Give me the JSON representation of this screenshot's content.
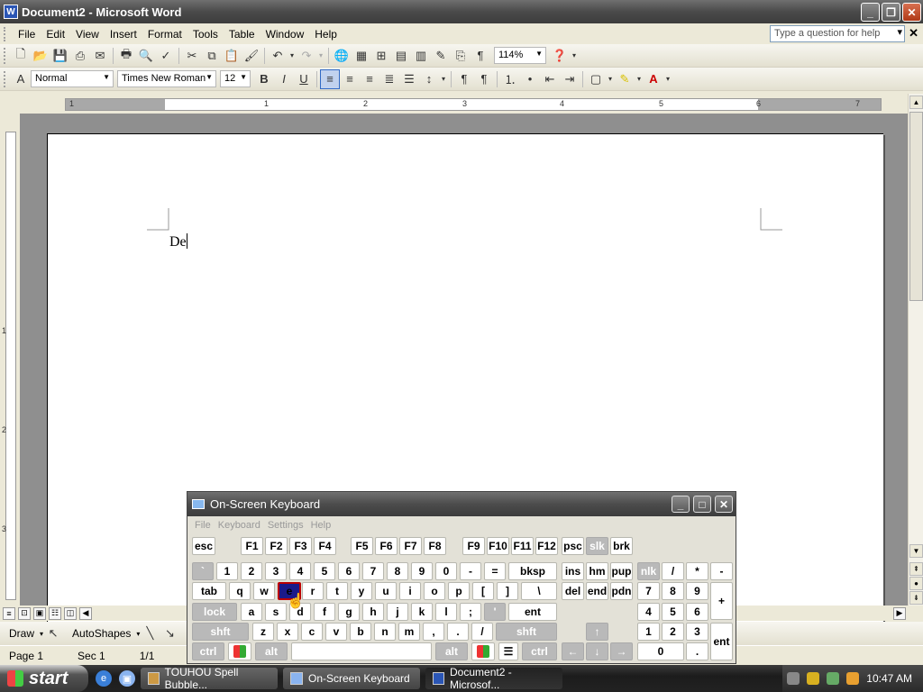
{
  "window": {
    "title": "Document2 - Microsoft Word",
    "icon_letter": "W"
  },
  "menu": {
    "items": [
      "File",
      "Edit",
      "View",
      "Insert",
      "Format",
      "Tools",
      "Table",
      "Window",
      "Help"
    ],
    "help_placeholder": "Type a question for help"
  },
  "formatting": {
    "style": "Normal",
    "font": "Times New Roman",
    "size": "12",
    "zoom": "114%"
  },
  "ruler": {
    "h_numbers": [
      "1",
      "1",
      "2",
      "3",
      "4",
      "5",
      "6",
      "7"
    ],
    "v_numbers": [
      "1",
      "2",
      "3"
    ]
  },
  "document": {
    "text": "De"
  },
  "drawbar": {
    "draw_label": "Draw",
    "autoshapes_label": "AutoShapes"
  },
  "status": {
    "page": "Page 1",
    "sec": "Sec 1",
    "pages": "1/1"
  },
  "osk": {
    "title": "On-Screen Keyboard",
    "menu": [
      "File",
      "Keyboard",
      "Settings",
      "Help"
    ],
    "keys": {
      "esc": "esc",
      "f1": "F1",
      "f2": "F2",
      "f3": "F3",
      "f4": "F4",
      "f5": "F5",
      "f6": "F6",
      "f7": "F7",
      "f8": "F8",
      "f9": "F9",
      "f10": "F10",
      "f11": "F11",
      "f12": "F12",
      "psc": "psc",
      "slk": "slk",
      "brk": "brk",
      "backtick": "`",
      "n1": "1",
      "n2": "2",
      "n3": "3",
      "n4": "4",
      "n5": "5",
      "n6": "6",
      "n7": "7",
      "n8": "8",
      "n9": "9",
      "n0": "0",
      "minus": "-",
      "equals": "=",
      "bksp": "bksp",
      "ins": "ins",
      "hm": "hm",
      "pup": "pup",
      "nlk": "nlk",
      "np_div": "/",
      "np_mul": "*",
      "np_sub": "-",
      "tab": "tab",
      "q": "q",
      "w": "w",
      "e": "e",
      "r": "r",
      "t": "t",
      "y": "y",
      "u": "u",
      "i": "i",
      "o": "o",
      "p": "p",
      "lbr": "[",
      "rbr": "]",
      "bslash": "\\",
      "del": "del",
      "end": "end",
      "pdn": "pdn",
      "np7": "7",
      "np8": "8",
      "np9": "9",
      "np_add": "+",
      "lock": "lock",
      "a": "a",
      "s": "s",
      "d": "d",
      "f": "f",
      "g": "g",
      "h": "h",
      "j": "j",
      "k": "k",
      "l": "l",
      "semi": ";",
      "quote": "'",
      "ent": "ent",
      "np4": "4",
      "np5": "5",
      "np6": "6",
      "shft": "shft",
      "z": "z",
      "x": "x",
      "c": "c",
      "v": "v",
      "b": "b",
      "n": "n",
      "m": "m",
      "comma": ",",
      "period": ".",
      "slash": "/",
      "rshft": "shft",
      "up": "↑",
      "np1": "1",
      "np2": "2",
      "np3": "3",
      "np_ent": "ent",
      "ctrl": "ctrl",
      "alt": "alt",
      "ralt": "alt",
      "rctrl": "ctrl",
      "left": "←",
      "down": "↓",
      "right": "→",
      "np0": "0",
      "np_dot": "."
    }
  },
  "taskbar": {
    "start": "start",
    "tasks": [
      "TOUHOU Spell Bubble...",
      "On-Screen Keyboard",
      "Document2 - Microsof..."
    ],
    "clock": "10:47 AM"
  }
}
